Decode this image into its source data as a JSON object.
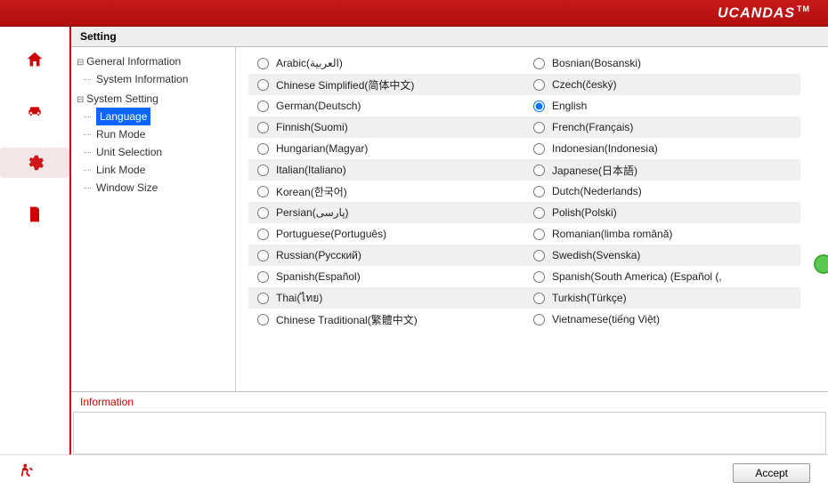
{
  "brand": "UCANDAS",
  "brand_tm": "TM",
  "page_title": "Setting",
  "tree": {
    "general_info": "General Information",
    "system_information": "System Information",
    "system_setting": "System Setting",
    "language": "Language",
    "run_mode": "Run Mode",
    "unit_selection": "Unit Selection",
    "link_mode": "Link Mode",
    "window_size": "Window Size"
  },
  "languages_col1": [
    "Arabic(العربية)",
    "Chinese Simplified(简体中文)",
    "German(Deutsch)",
    "Finnish(Suomi)",
    "Hungarian(Magyar)",
    "Italian(Italiano)",
    "Korean(한국어)",
    "Persian(پارسی)",
    "Portuguese(Português)",
    "Russian(Русский)",
    "Spanish(Español)",
    "Thai(ไทย)",
    "Chinese Traditional(繁體中文)"
  ],
  "languages_col2": [
    "Bosnian(Bosanski)",
    "Czech(český)",
    "English",
    "French(Français)",
    "Indonesian(Indonesia)",
    "Japanese(日本語)",
    "Dutch(Nederlands)",
    "Polish(Polski)",
    "Romanian(limba română)",
    "Swedish(Svenska)",
    "Spanish(South America) (Español (,",
    "Turkish(Türkçe)",
    "Vietnamese(tiếng Việt)"
  ],
  "selected_language": "English",
  "info_title": "Information",
  "accept_label": "Accept"
}
